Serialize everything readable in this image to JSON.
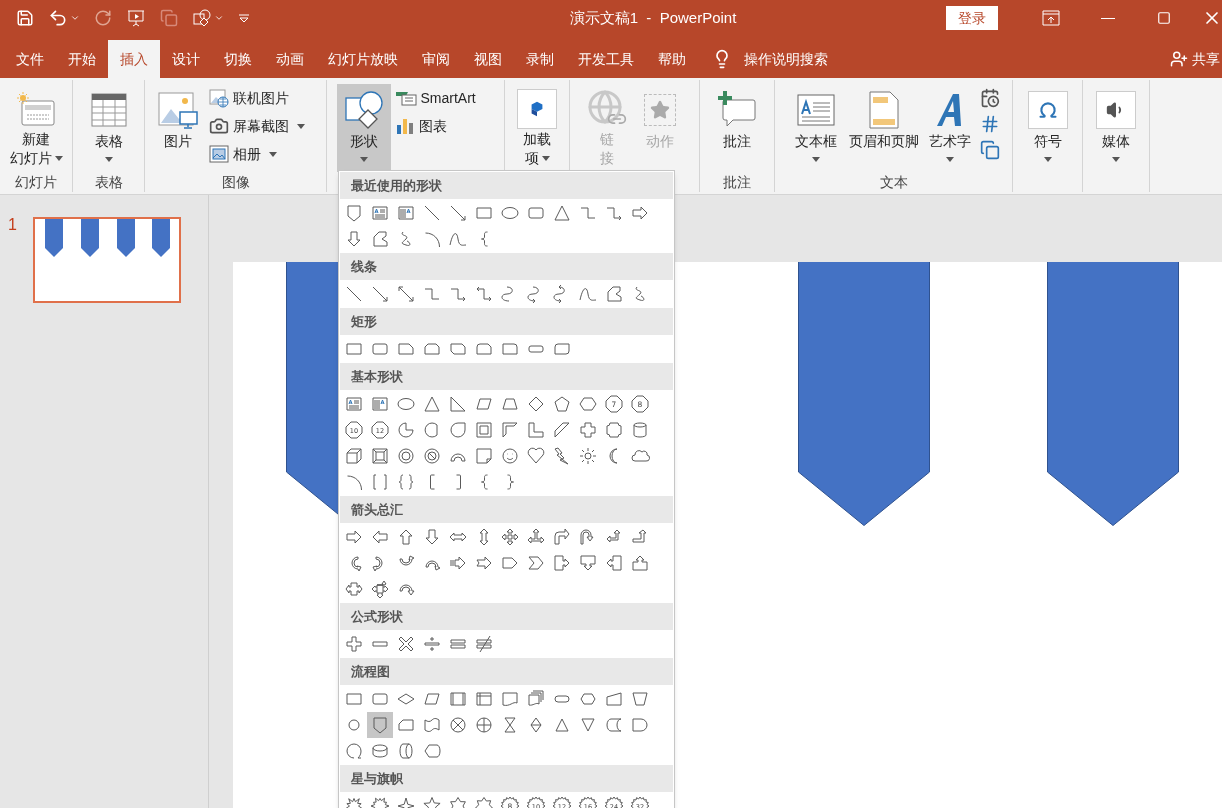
{
  "title_bar": {
    "title": "演示文稿1  -  PowerPoint",
    "login_button": "登录"
  },
  "menu_tabs": [
    {
      "label": "文件",
      "selected": false
    },
    {
      "label": "开始",
      "selected": false
    },
    {
      "label": "插入",
      "selected": true
    },
    {
      "label": "设计",
      "selected": false
    },
    {
      "label": "切换",
      "selected": false
    },
    {
      "label": "动画",
      "selected": false
    },
    {
      "label": "幻灯片放映",
      "selected": false
    },
    {
      "label": "审阅",
      "selected": false
    },
    {
      "label": "视图",
      "selected": false
    },
    {
      "label": "录制",
      "selected": false
    },
    {
      "label": "开发工具",
      "selected": false
    },
    {
      "label": "帮助",
      "selected": false
    }
  ],
  "tell_me": "操作说明搜索",
  "share": "共享",
  "ribbon": {
    "slides": {
      "label": "幻灯片",
      "new_slide": {
        "label": [
          "新建",
          "幻灯片"
        ],
        "dropdown": true
      }
    },
    "tables": {
      "label": "表格",
      "table": {
        "label": "表格",
        "dropdown": true
      }
    },
    "images": {
      "label": "图像",
      "pictures": {
        "label": "图片"
      },
      "online_pictures": {
        "label": "联机图片"
      },
      "screenshot": {
        "label": "屏幕截图",
        "dropdown": true
      },
      "photo_album": {
        "label": "相册",
        "dropdown": true
      }
    },
    "illustrations": {
      "shapes": {
        "label": "形状",
        "dropdown": true,
        "pressed": true
      },
      "smartart": {
        "label": "SmartArt"
      },
      "chart": {
        "label": "图表"
      }
    },
    "addins": {
      "addins": {
        "label": [
          "加载",
          "项"
        ],
        "dropdown": true
      }
    },
    "links": {
      "link": {
        "label": [
          "链",
          "接"
        ],
        "disabled": true
      },
      "action": {
        "label": "动作",
        "disabled": true
      }
    },
    "comments": {
      "label": "批注",
      "comment": {
        "label": "批注"
      }
    },
    "text": {
      "label": "文本",
      "textbox": {
        "label": "文本框",
        "dropdown": true
      },
      "header_footer": {
        "label": "页眉和页脚"
      },
      "wordart": {
        "label": "艺术字",
        "dropdown": true
      }
    },
    "symbols": {
      "symbol": {
        "label": "符号",
        "dropdown": true
      }
    },
    "media": {
      "media": {
        "label": "媒体",
        "dropdown": true
      }
    }
  },
  "thumbnails": [
    {
      "number": "1",
      "selected": true
    }
  ],
  "shapes_menu": {
    "sections": [
      {
        "title": "最近使用的形状",
        "shapes": [
          {
            "kind": "offpage",
            "selected": false
          },
          {
            "kind": "textbox",
            "selected": false
          },
          {
            "kind": "vtextbox",
            "selected": false
          },
          {
            "kind": "line",
            "selected": false
          },
          {
            "kind": "arrowline",
            "selected": false
          },
          {
            "kind": "rect",
            "selected": false
          },
          {
            "kind": "ellipse",
            "selected": false
          },
          {
            "kind": "roundrect",
            "selected": false
          },
          {
            "kind": "triangle",
            "selected": false
          },
          {
            "kind": "elbow",
            "selected": false
          },
          {
            "kind": "elbowarrow",
            "selected": false
          },
          {
            "kind": "rarrow",
            "selected": false
          },
          {
            "kind": "darrow",
            "selected": false
          },
          {
            "kind": "freeform",
            "selected": false
          },
          {
            "kind": "scribble",
            "selected": false
          },
          {
            "kind": "arc",
            "selected": false
          },
          {
            "kind": "curve",
            "selected": false
          },
          {
            "kind": "bracel",
            "selected": false
          }
        ]
      },
      {
        "title": "线条",
        "shapes": [
          {
            "kind": "line",
            "selected": false
          },
          {
            "kind": "arrowline",
            "selected": false
          },
          {
            "kind": "dblarrowline",
            "selected": false
          },
          {
            "kind": "elbow",
            "selected": false
          },
          {
            "kind": "elbowarrow",
            "selected": false
          },
          {
            "kind": "elbowdbl",
            "selected": false
          },
          {
            "kind": "curveconn",
            "selected": false
          },
          {
            "kind": "curvearrow",
            "selected": false
          },
          {
            "kind": "curvedbl",
            "selected": false
          },
          {
            "kind": "curve",
            "selected": false
          },
          {
            "kind": "freeform",
            "selected": false
          },
          {
            "kind": "scribble",
            "selected": false
          }
        ]
      },
      {
        "title": "矩形",
        "shapes": [
          {
            "kind": "rect",
            "selected": false
          },
          {
            "kind": "roundrect",
            "selected": false
          },
          {
            "kind": "snip1",
            "selected": false
          },
          {
            "kind": "snip2",
            "selected": false
          },
          {
            "kind": "snipdiag",
            "selected": false
          },
          {
            "kind": "snipround",
            "selected": false
          },
          {
            "kind": "round1",
            "selected": false
          },
          {
            "kind": "flatround",
            "selected": false
          },
          {
            "kind": "rounddiag",
            "selected": false
          }
        ]
      },
      {
        "title": "基本形状",
        "shapes": [
          {
            "kind": "textbox",
            "selected": false
          },
          {
            "kind": "vtextbox",
            "selected": false
          },
          {
            "kind": "ellipse",
            "selected": false
          },
          {
            "kind": "triangle",
            "selected": false
          },
          {
            "kind": "rtriangle",
            "selected": false
          },
          {
            "kind": "parallelogram",
            "selected": false
          },
          {
            "kind": "trapezoid",
            "selected": false
          },
          {
            "kind": "diamond",
            "selected": false
          },
          {
            "kind": "pentagon",
            "selected": false
          },
          {
            "kind": "hexagon",
            "selected": false
          },
          {
            "kind": "polygon",
            "label": "7",
            "selected": false
          },
          {
            "kind": "polygon",
            "label": "8",
            "selected": false
          },
          {
            "kind": "polygon",
            "label": "10",
            "selected": false
          },
          {
            "kind": "polygon",
            "label": "12",
            "selected": false
          },
          {
            "kind": "pie",
            "selected": false
          },
          {
            "kind": "chord",
            "selected": false
          },
          {
            "kind": "teardrop",
            "selected": false
          },
          {
            "kind": "frame",
            "selected": false
          },
          {
            "kind": "halfframe",
            "selected": false
          },
          {
            "kind": "lshape",
            "selected": false
          },
          {
            "kind": "diagstripe",
            "selected": false
          },
          {
            "kind": "cross",
            "selected": false
          },
          {
            "kind": "plaque",
            "selected": false
          },
          {
            "kind": "can",
            "selected": false
          },
          {
            "kind": "cube",
            "selected": false
          },
          {
            "kind": "bevel",
            "selected": false
          },
          {
            "kind": "donut",
            "selected": false
          },
          {
            "kind": "noentry",
            "selected": false
          },
          {
            "kind": "blockarc",
            "selected": false
          },
          {
            "kind": "foldedcorner",
            "selected": false
          },
          {
            "kind": "smiley",
            "selected": false
          },
          {
            "kind": "heart",
            "selected": false
          },
          {
            "kind": "lightning",
            "selected": false
          },
          {
            "kind": "sun",
            "selected": false
          },
          {
            "kind": "moon",
            "selected": false
          },
          {
            "kind": "cloud",
            "selected": false
          },
          {
            "kind": "arc",
            "selected": false
          },
          {
            "kind": "bracketpair",
            "selected": false
          },
          {
            "kind": "bracepair",
            "selected": false
          },
          {
            "kind": "bracketl",
            "selected": false
          },
          {
            "kind": "bracketr",
            "selected": false
          },
          {
            "kind": "bracel",
            "selected": false
          },
          {
            "kind": "bracer",
            "selected": false
          }
        ]
      },
      {
        "title": "箭头总汇",
        "shapes": [
          {
            "kind": "rarrow",
            "selected": false
          },
          {
            "kind": "larrow",
            "selected": false
          },
          {
            "kind": "uarrow",
            "selected": false
          },
          {
            "kind": "darrow",
            "selected": false
          },
          {
            "kind": "lrarrow",
            "selected": false
          },
          {
            "kind": "udarrow",
            "selected": false
          },
          {
            "kind": "quadarrow",
            "selected": false
          },
          {
            "kind": "lruparrow",
            "selected": false
          },
          {
            "kind": "bentarrow",
            "selected": false
          },
          {
            "kind": "uturn",
            "selected": false
          },
          {
            "kind": "leftuparrow",
            "selected": false
          },
          {
            "kind": "bentuparrow",
            "selected": false
          },
          {
            "kind": "curvedright",
            "selected": false
          },
          {
            "kind": "curvedleft",
            "selected": false
          },
          {
            "kind": "curvedup",
            "selected": false
          },
          {
            "kind": "curveddown",
            "selected": false
          },
          {
            "kind": "striped",
            "selected": false
          },
          {
            "kind": "notched",
            "selected": false
          },
          {
            "kind": "homeplate",
            "selected": false
          },
          {
            "kind": "chevron",
            "selected": false
          },
          {
            "kind": "rcallout",
            "selected": false
          },
          {
            "kind": "dcallout",
            "selected": false
          },
          {
            "kind": "lcallout",
            "selected": false
          },
          {
            "kind": "ucallout",
            "selected": false
          },
          {
            "kind": "lrcallout",
            "selected": false
          },
          {
            "kind": "quadcallout",
            "selected": false
          },
          {
            "kind": "circular",
            "selected": false
          }
        ]
      },
      {
        "title": "公式形状",
        "shapes": [
          {
            "kind": "mathplus",
            "selected": false
          },
          {
            "kind": "mathminus",
            "selected": false
          },
          {
            "kind": "mathmultiply",
            "selected": false
          },
          {
            "kind": "mathdivide",
            "selected": false
          },
          {
            "kind": "mathequal",
            "selected": false
          },
          {
            "kind": "mathnotequal",
            "selected": false
          }
        ]
      },
      {
        "title": "流程图",
        "shapes": [
          {
            "kind": "rect",
            "selected": false
          },
          {
            "kind": "roundrect",
            "selected": false
          },
          {
            "kind": "decision",
            "selected": false
          },
          {
            "kind": "parallelogram",
            "selected": false
          },
          {
            "kind": "predefined",
            "selected": false
          },
          {
            "kind": "internal",
            "selected": false
          },
          {
            "kind": "document",
            "selected": false
          },
          {
            "kind": "multidoc",
            "selected": false
          },
          {
            "kind": "terminator",
            "selected": false
          },
          {
            "kind": "preparation",
            "selected": false
          },
          {
            "kind": "manualinput",
            "selected": false
          },
          {
            "kind": "manualop",
            "selected": false
          },
          {
            "kind": "connector",
            "selected": false
          },
          {
            "kind": "offpage",
            "selected": true
          },
          {
            "kind": "card",
            "selected": false
          },
          {
            "kind": "punchedtape",
            "selected": false
          },
          {
            "kind": "summing",
            "selected": false
          },
          {
            "kind": "or",
            "selected": false
          },
          {
            "kind": "collate",
            "selected": false
          },
          {
            "kind": "sort",
            "selected": false
          },
          {
            "kind": "extract",
            "selected": false
          },
          {
            "kind": "merge",
            "selected": false
          },
          {
            "kind": "storeddata",
            "selected": false
          },
          {
            "kind": "delay",
            "selected": false
          },
          {
            "kind": "seqaccess",
            "selected": false
          },
          {
            "kind": "magdisk",
            "selected": false
          },
          {
            "kind": "directaccess",
            "selected": false
          },
          {
            "kind": "display",
            "selected": false
          }
        ]
      },
      {
        "title": "星与旗帜",
        "shapes": [
          {
            "kind": "explosion1",
            "selected": false
          },
          {
            "kind": "explosion2",
            "selected": false
          },
          {
            "kind": "star4",
            "selected": false
          },
          {
            "kind": "star5",
            "selected": false
          },
          {
            "kind": "star6",
            "selected": false
          },
          {
            "kind": "star7",
            "selected": false
          },
          {
            "kind": "seal",
            "label": "8",
            "selected": false
          },
          {
            "kind": "seal",
            "label": "10",
            "selected": false
          },
          {
            "kind": "seal",
            "label": "12",
            "selected": false
          },
          {
            "kind": "seal",
            "label": "16",
            "selected": false
          },
          {
            "kind": "seal",
            "label": "24",
            "selected": false
          },
          {
            "kind": "seal",
            "label": "32",
            "selected": false
          }
        ]
      }
    ]
  }
}
